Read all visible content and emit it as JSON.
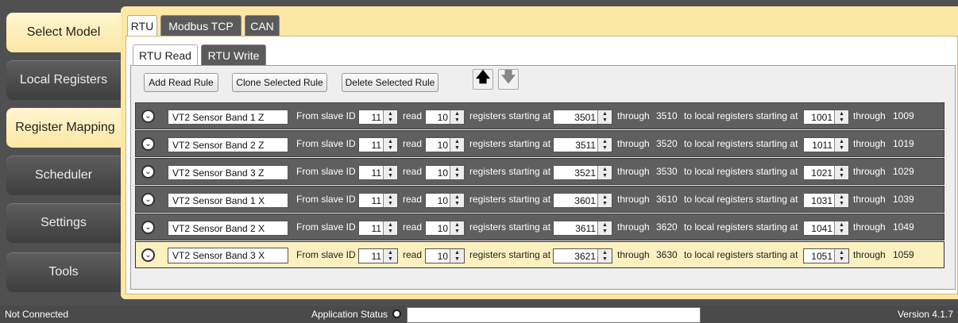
{
  "sidebar": {
    "items": [
      {
        "label": "Select Model",
        "active": true
      },
      {
        "label": "Local Registers",
        "active": false
      },
      {
        "label": "Register Mapping",
        "active": true
      },
      {
        "label": "Scheduler",
        "active": false
      },
      {
        "label": "Settings",
        "active": false
      },
      {
        "label": "Tools",
        "active": false
      }
    ]
  },
  "protocol_tabs": [
    "RTU",
    "Modbus TCP",
    "CAN"
  ],
  "rtu_tabs": [
    "RTU Read",
    "RTU Write"
  ],
  "toolbar": {
    "add_label": "Add Read Rule",
    "clone_label": "Clone Selected Rule",
    "delete_label": "Delete Selected Rule",
    "move_up_icon": "arrow-up-icon",
    "move_down_icon": "arrow-down-icon"
  },
  "row_labels": {
    "from_slave": "From slave ID",
    "read": "read",
    "registers_starting": "registers starting at",
    "through": "through",
    "local_starting": "to local registers starting at"
  },
  "rules": [
    {
      "name": "VT2 Sensor Band 1 Z",
      "slave_id": "11",
      "count": "10",
      "start": "3501",
      "end": "3510",
      "local_start": "1001",
      "local_end": "1009",
      "selected": false
    },
    {
      "name": "VT2 Sensor Band 2 Z",
      "slave_id": "11",
      "count": "10",
      "start": "3511",
      "end": "3520",
      "local_start": "1011",
      "local_end": "1019",
      "selected": false
    },
    {
      "name": "VT2 Sensor Band 3 Z",
      "slave_id": "11",
      "count": "10",
      "start": "3521",
      "end": "3530",
      "local_start": "1021",
      "local_end": "1029",
      "selected": false
    },
    {
      "name": "VT2 Sensor Band 1 X",
      "slave_id": "11",
      "count": "10",
      "start": "3601",
      "end": "3610",
      "local_start": "1031",
      "local_end": "1039",
      "selected": false
    },
    {
      "name": "VT2 Sensor Band 2 X",
      "slave_id": "11",
      "count": "10",
      "start": "3611",
      "end": "3620",
      "local_start": "1041",
      "local_end": "1049",
      "selected": false
    },
    {
      "name": "VT2 Sensor Band 3 X",
      "slave_id": "11",
      "count": "10",
      "start": "3621",
      "end": "3630",
      "local_start": "1051",
      "local_end": "1059",
      "selected": true
    }
  ],
  "status": {
    "connection": "Not Connected",
    "app_status_label": "Application Status",
    "version": "Version 4.1.7"
  },
  "colors": {
    "accent": "#fbe8a4",
    "row_bg": "#5f5f5f",
    "selected_row_bg": "#fbf0c0",
    "background": "#505050"
  }
}
